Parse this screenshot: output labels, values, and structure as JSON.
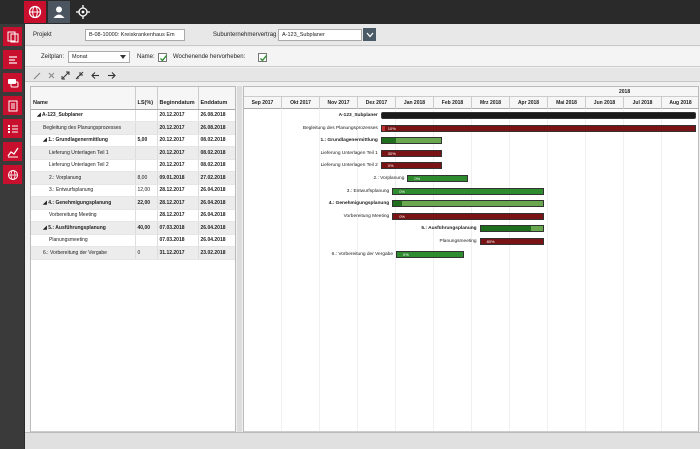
{
  "colors": {
    "accent": "#c8102e",
    "dark": "#2a2a2a",
    "green": "#2e8b2e",
    "darkred": "#7a1414",
    "summary": "#1a1a1a"
  },
  "topbar": {
    "icons": [
      "globe-icon",
      "user-icon",
      "target-icon"
    ]
  },
  "sidebar": {
    "icons": [
      "overview-icon",
      "schedule-icon",
      "chat-icon",
      "document-icon",
      "checklist-icon",
      "chart-icon",
      "globe-icon"
    ]
  },
  "form": {
    "projekt_label": "Projekt",
    "projekt_value": "B-08-10000: Kreiskrankenhaus Em",
    "vertrag_label": "Subunternehmervertrag",
    "vertrag_value": "A-123_Subplaner",
    "zeitplan_label": "Zeitplan:",
    "zeitplan_value": "Monat",
    "name_label": "Name:",
    "wochenende_label": "Wochenende hervorheben:"
  },
  "table": {
    "headers": [
      "Name",
      "LS(%)",
      "Beginndatum",
      "Enddatum"
    ],
    "rows": [
      {
        "name": "◢ A-123_Subplaner",
        "ls": "",
        "begin": "20.12.2017",
        "end": "26.08.2018",
        "bold": true,
        "indent": 1
      },
      {
        "name": "Begleitung des Planungsprozesses",
        "ls": "",
        "begin": "20.12.2017",
        "end": "26.08.2018",
        "bold": false,
        "indent": 2
      },
      {
        "name": "◢ 1.: Grundlagenermittlung",
        "ls": "5,00",
        "begin": "20.12.2017",
        "end": "08.02.2018",
        "bold": true,
        "indent": 2
      },
      {
        "name": "Lieferung Unterlagen Teil 1",
        "ls": "",
        "begin": "20.12.2017",
        "end": "08.02.2018",
        "bold": false,
        "indent": 3
      },
      {
        "name": "Lieferung Unterlagen Teil 2",
        "ls": "",
        "begin": "20.12.2017",
        "end": "08.02.2018",
        "bold": false,
        "indent": 3
      },
      {
        "name": "2.: Vorplanung",
        "ls": "8,00",
        "begin": "09.01.2018",
        "end": "27.02.2018",
        "bold": false,
        "indent": 3
      },
      {
        "name": "3.: Entwurfsplanung",
        "ls": "12,00",
        "begin": "28.12.2017",
        "end": "26.04.2018",
        "bold": false,
        "indent": 3
      },
      {
        "name": "◢ 4.: Genehmigungsplanung",
        "ls": "22,00",
        "begin": "28.12.2017",
        "end": "26.04.2018",
        "bold": true,
        "indent": 2
      },
      {
        "name": "Vorbereitung Meeting",
        "ls": "",
        "begin": "28.12.2017",
        "end": "26.04.2018",
        "bold": false,
        "indent": 3
      },
      {
        "name": "◢ 5.: Ausführungsplanung",
        "ls": "40,00",
        "begin": "07.03.2018",
        "end": "26.04.2018",
        "bold": true,
        "indent": 2
      },
      {
        "name": "Planungsmeeting",
        "ls": "",
        "begin": "07.03.2018",
        "end": "26.04.2018",
        "bold": false,
        "indent": 3
      },
      {
        "name": "6.: Vorbereitung der Vergabe",
        "ls": "0",
        "begin": "31.12.2017",
        "end": "23.02.2018",
        "bold": false,
        "indent": 2
      }
    ]
  },
  "gantt": {
    "year": "2018",
    "months": [
      "Sep 2017",
      "Okt 2017",
      "Nov 2017",
      "Dez 2017",
      "Jan 2018",
      "Feb 2018",
      "Mrz 2018",
      "Apr 2018",
      "Mai 2018",
      "Jun 2018",
      "Jul 2018",
      "Aug 2018"
    ],
    "tasks": [
      {
        "label": "A-123_Subplaner",
        "bold": true,
        "type": "summary",
        "start": 3.6,
        "end": 11.9,
        "progress": 0,
        "pct": ""
      },
      {
        "label": "Begleitung des Planungsprozesses",
        "bold": false,
        "type": "red",
        "start": 3.6,
        "end": 11.9,
        "progress": 0.01,
        "pct": "10%"
      },
      {
        "label": "1.: Grundlagenermittlung",
        "bold": true,
        "type": "green",
        "start": 3.6,
        "end": 5.2,
        "progress": 0.25,
        "pct": ""
      },
      {
        "label": "Lieferung Unterlagen Teil 1",
        "bold": false,
        "type": "red",
        "start": 3.6,
        "end": 5.2,
        "progress": 0,
        "pct": "30%"
      },
      {
        "label": "Lieferung Unterlagen Teil 2",
        "bold": false,
        "type": "red",
        "start": 3.6,
        "end": 5.2,
        "progress": 0,
        "pct": "0%"
      },
      {
        "label": "2.: Vorplanung",
        "bold": false,
        "type": "green",
        "start": 4.3,
        "end": 5.9,
        "progress": 0,
        "pct": "0%"
      },
      {
        "label": "3.: Entwurfsplanung",
        "bold": false,
        "type": "green",
        "start": 3.9,
        "end": 7.9,
        "progress": 0,
        "pct": "0%"
      },
      {
        "label": "4.: Genehmigungsplanung",
        "bold": true,
        "type": "green",
        "start": 3.9,
        "end": 7.9,
        "progress": 0.06,
        "pct": ""
      },
      {
        "label": "Vorbereitung Meeting",
        "bold": false,
        "type": "red",
        "start": 3.9,
        "end": 7.9,
        "progress": 0,
        "pct": "0%"
      },
      {
        "label": "5.: Ausführungsplanung",
        "bold": true,
        "type": "green",
        "start": 6.2,
        "end": 7.9,
        "progress": 0.8,
        "pct": ""
      },
      {
        "label": "Planungsmeeting",
        "bold": false,
        "type": "red",
        "start": 6.2,
        "end": 7.9,
        "progress": 0,
        "pct": "80%"
      },
      {
        "label": "6.: Vorbereitung der Vergabe",
        "bold": false,
        "type": "green",
        "start": 4.0,
        "end": 5.8,
        "progress": 0,
        "pct": "0%"
      }
    ]
  }
}
